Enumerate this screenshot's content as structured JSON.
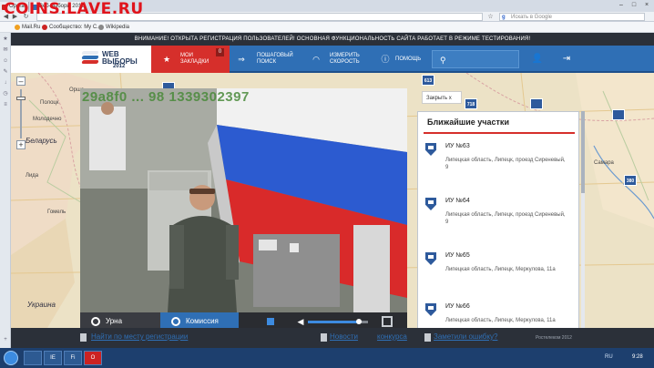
{
  "watermark_text": "COINS.LAVE.RU",
  "browser": {
    "tabs": [
      {
        "label": "Opera"
      },
      {
        "label": "Веб-выборы 2012"
      }
    ],
    "search_placeholder": "Искать в Google",
    "bookmarks": [
      {
        "label": "Mail.Ru",
        "color": "#f0a020"
      },
      {
        "label": "Сообщество: My C...",
        "color": "#cc2222"
      },
      {
        "label": "Wikipedia",
        "color": "#888888"
      }
    ]
  },
  "site": {
    "announcement": "ВНИМАНИЕ! ОТКРЫТА РЕГИСТРАЦИЯ ПОЛЬЗОВАТЕЛЕЙ! ОСНОВНАЯ ФУНКЦИОНАЛЬНОСТЬ САЙТА РАБОТАЕТ В РЕЖИМЕ ТЕСТИРОВАНИЯ!",
    "logo": {
      "line1": "WEB",
      "line2": "ВЫБОРЫ",
      "line3": "2012"
    },
    "nav": {
      "favorites": {
        "label": "МОИ\nЗАКЛАДКИ",
        "badge": "0",
        "icon": "star-icon"
      },
      "step_search": {
        "label": "ПОШАГОВЫЙ\nПОИСК",
        "icon": "arrows-icon"
      },
      "speed": {
        "label": "ИЗМЕРИТЬ\nСКОРОСТЬ",
        "icon": "speedometer-icon"
      },
      "help": {
        "label": "ПОМОЩЬ",
        "icon": "info-icon"
      }
    },
    "accent_color": "#d62f2b",
    "nav_color": "#2f6fb5"
  },
  "map": {
    "labels": {
      "belarus": "Беларусь",
      "ukraine": "Украина",
      "samara": "Самара",
      "polotsk": "Полоцк",
      "orsha": "Орша",
      "minsk_area": "Молодечно",
      "gomel": "Гомель",
      "lida": "Лида"
    },
    "pins": [
      "613",
      "718",
      "380"
    ]
  },
  "video": {
    "timestamp": "29a8f0 ... 98 1339302397",
    "tabs": {
      "urn": "Урна",
      "commission": "Комиссия"
    },
    "volume_fraction": 0.85
  },
  "close_label": "Закрыть",
  "close_glyph": "x",
  "nearby": {
    "title": "Ближайшие участки",
    "stations": [
      {
        "title": "ИУ №63",
        "address": "Липецкая область, Липецк, проезд Сиреневый, 9"
      },
      {
        "title": "ИУ №64",
        "address": "Липецкая область, Липецк, проезд Сиреневый, 9"
      },
      {
        "title": "ИУ №65",
        "address": "Липецкая область, Липецк, Меркулова, 11а"
      },
      {
        "title": "ИУ №66",
        "address": "Липецкая область, Липецк, Меркулова, 11а"
      }
    ]
  },
  "footer": {
    "register_link": "Найти по месту регистрации",
    "news_link": "Новости",
    "contest_link": "конкурса",
    "feedback_link": "Заметили ошибку?",
    "copyright": "Ростелеком 2012"
  },
  "taskbar": {
    "clock": "9:28",
    "lang": "RU",
    "apps": [
      "IE",
      "Fi"
    ]
  }
}
